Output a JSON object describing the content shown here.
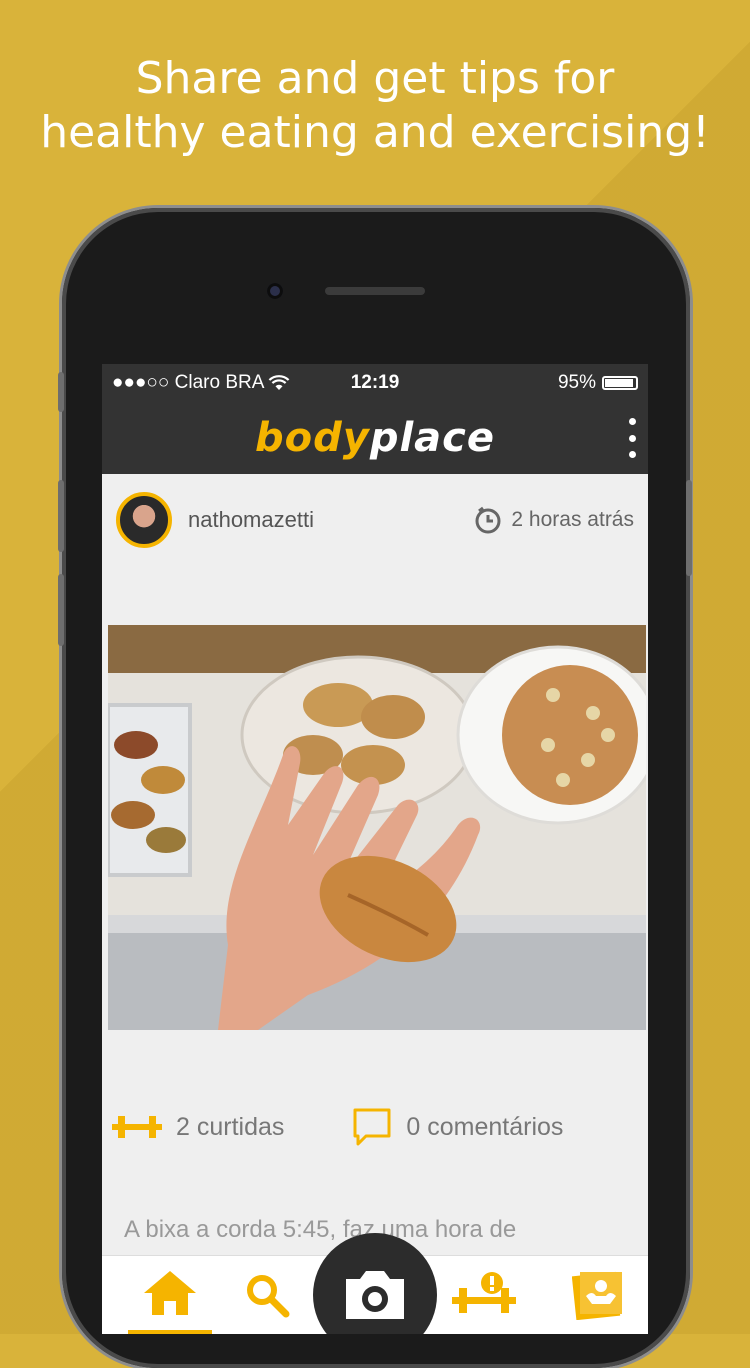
{
  "headline": {
    "line1": "Share and get tips for",
    "line2": "healthy eating and exercising!"
  },
  "status_bar": {
    "carrier": "●●●○○ Claro BRA",
    "time": "12:19",
    "battery": "95%",
    "battery_level": 0.95
  },
  "app": {
    "logo_part1": "body",
    "logo_part2": "place"
  },
  "post": {
    "username": "nathomazetti",
    "time_ago": "2 horas atrás",
    "likes": "2 curtidas",
    "comments": "0 comentários",
    "caption": "A bixa a corda 5:45, faz uma hora de"
  },
  "colors": {
    "background": "#d9b33a",
    "accent": "#f5b400",
    "bar": "#333333"
  },
  "tabs": [
    "home-icon",
    "search-icon",
    "camera-icon",
    "workout-alert-icon",
    "profile-icon"
  ]
}
